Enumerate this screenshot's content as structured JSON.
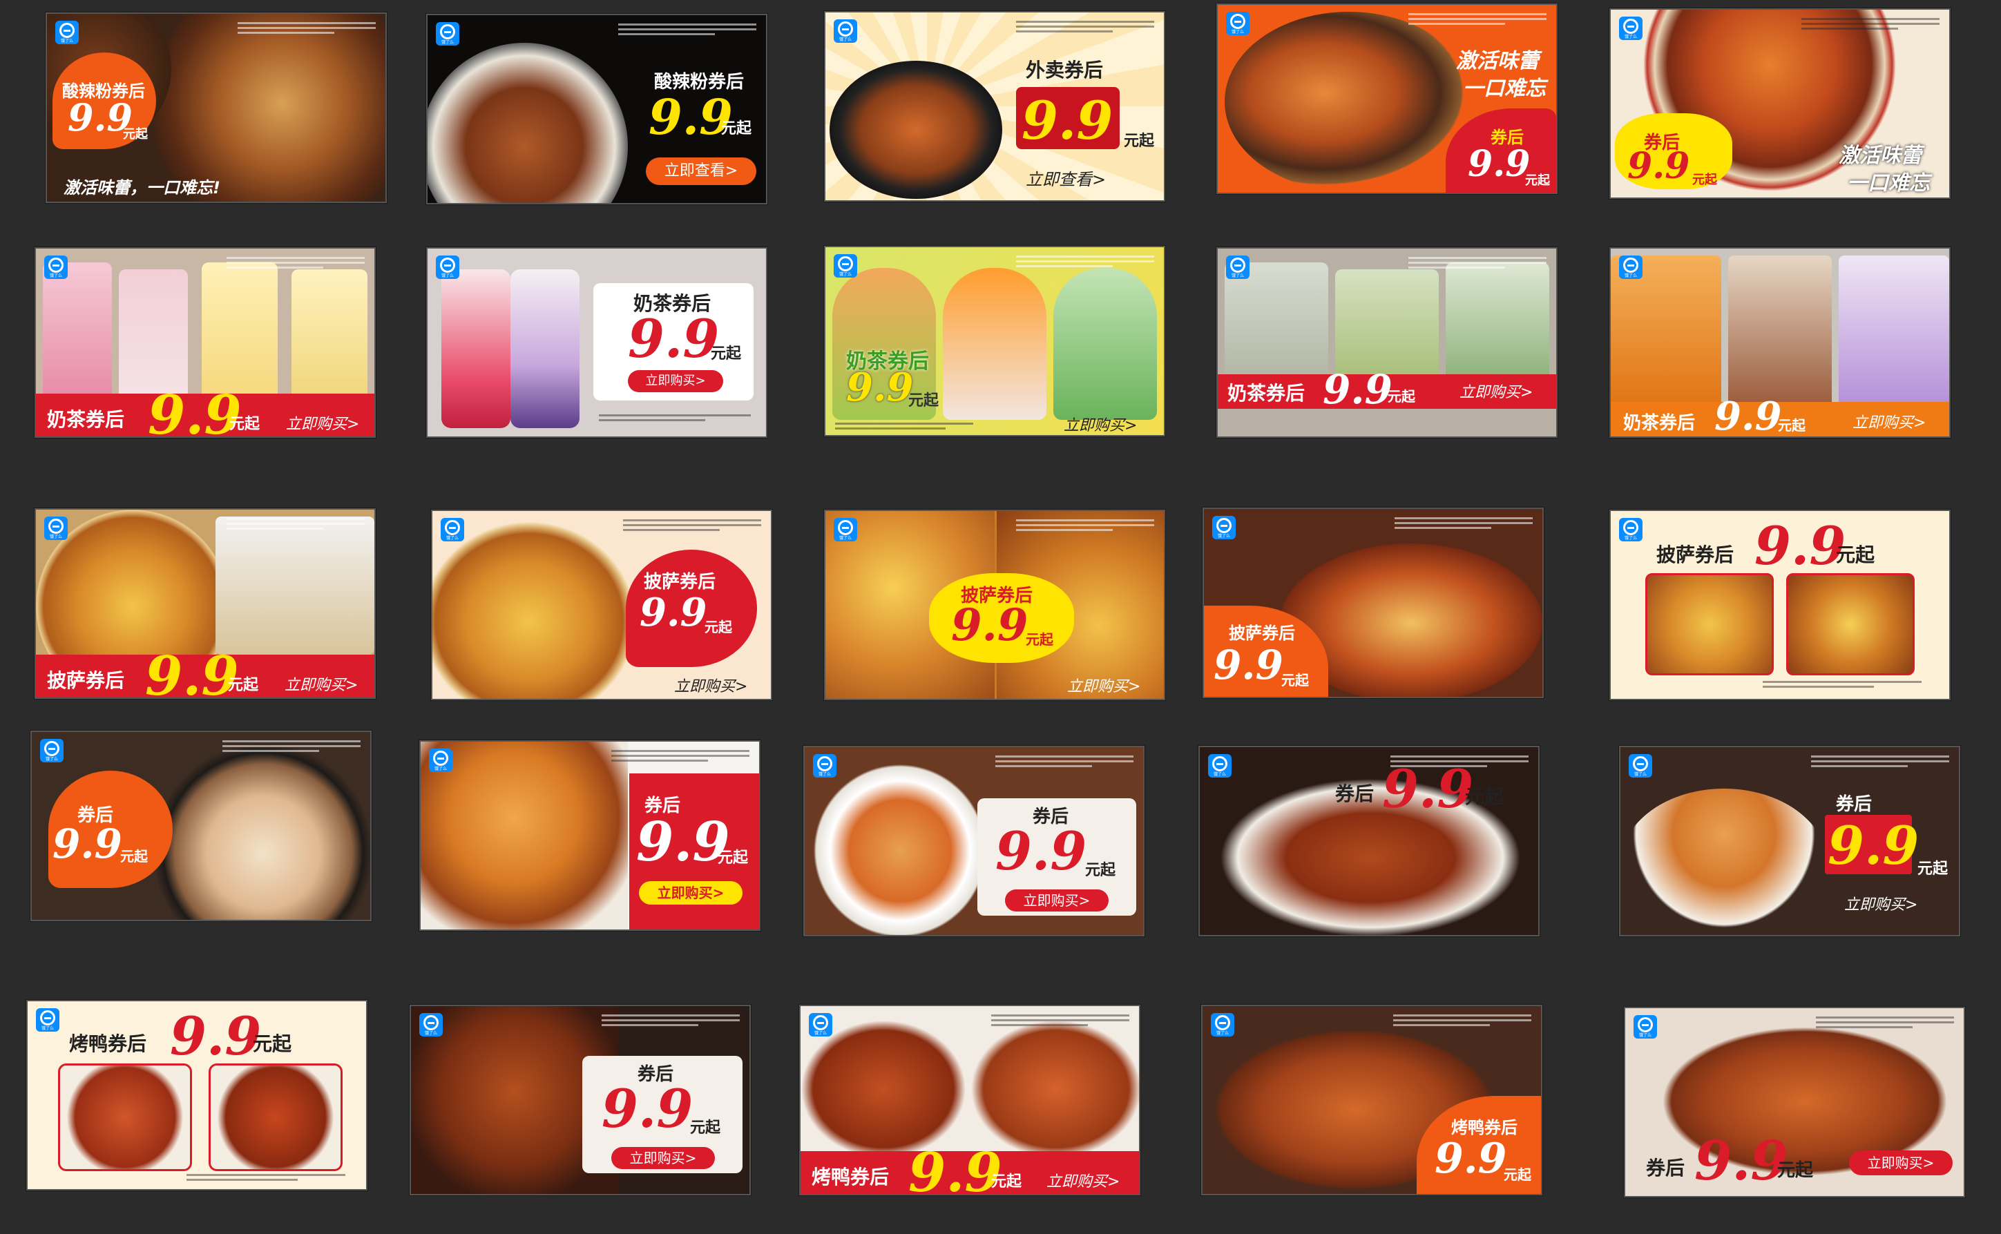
{
  "colors": {
    "background": "#2b2b2b",
    "red": "#d91b2a",
    "orange": "#f05a14",
    "yellow": "#ffe400",
    "white": "#ffffff"
  },
  "logo": {
    "icon": "eleme-icon",
    "text": "饿了么"
  },
  "text": {
    "t_sunlafen": "酸辣粉券后",
    "t_99": "9.9",
    "t_yuanqi": "元起",
    "t_jihuo_yikou": "激活味蕾，一口难忘!",
    "t_lijichakan": "立即查看>",
    "t_waimai": "外卖券后",
    "t_jihuo": "激活味蕾",
    "t_yikou": "一口难忘",
    "t_quanhou": "券后",
    "t_naicha": "奶茶券后",
    "t_lijigoumai": "立即购买>",
    "t_pisa": "披萨券后",
    "t_kaoya": "烤鸭券后"
  }
}
